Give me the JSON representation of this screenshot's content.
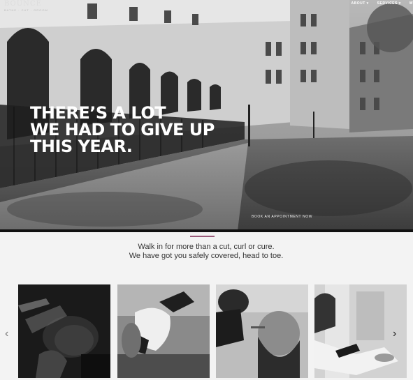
{
  "brand": {
    "logo": "BOUNCE",
    "sub": "BATHE · CUT · GROOM"
  },
  "nav": {
    "items": [
      "ABOUT ▾",
      "SERVICES ▾",
      "W"
    ]
  },
  "hero": {
    "headline_lines": [
      "THERE’S A LOT",
      "WE HAD TO GIVE UP",
      "THIS YEAR."
    ],
    "cta": "BOOK AN APPOINTMENT NOW"
  },
  "intro": {
    "line1": "Walk in for more than a cut, curl or cure.",
    "line2": "We have got you safely covered, head to toe."
  },
  "carousel": {
    "prev_icon": "chevron-left-icon",
    "next_icon": "chevron-right-icon",
    "cards": [
      {
        "subject": "barber-spraying-hair"
      },
      {
        "subject": "face-mask-treatment"
      },
      {
        "subject": "beard-trim"
      },
      {
        "subject": "manicure"
      }
    ]
  },
  "colors": {
    "accent": "#9a5a7a",
    "text": "#333333",
    "background": "#f3f3f3"
  }
}
